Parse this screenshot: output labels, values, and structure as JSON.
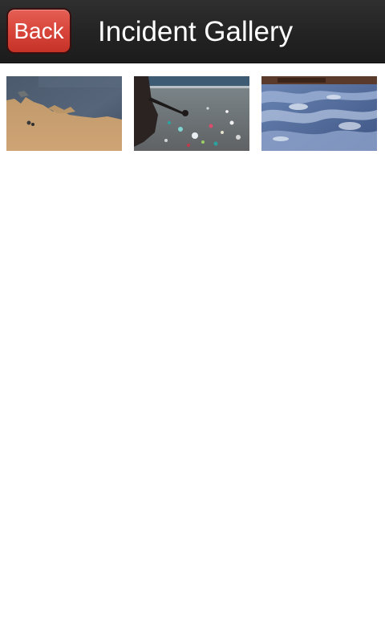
{
  "header": {
    "back_label": "Back",
    "title": "Incident Gallery"
  },
  "gallery": {
    "photos": [
      {
        "subject": "sediment-plume-photo"
      },
      {
        "subject": "littered-shoreline-photo"
      },
      {
        "subject": "polluted-foam-water-photo"
      }
    ]
  },
  "colors": {
    "header_background": "#262626",
    "back_button": "#d8453a",
    "page_background": "#ffffff"
  }
}
